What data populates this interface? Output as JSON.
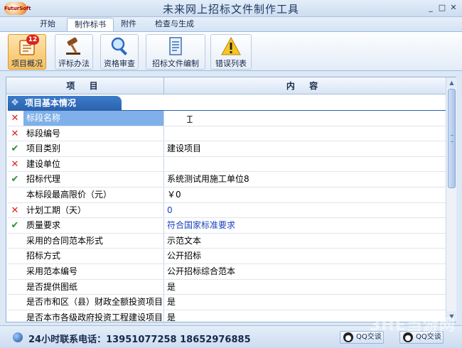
{
  "app": {
    "title": "未来网上招标文件制作工具",
    "logo_text": "FuturSoft"
  },
  "window": {
    "min": "_",
    "max": "□",
    "close": "✕"
  },
  "tabs": [
    "开始",
    "制作标书",
    "附件",
    "检查与生成"
  ],
  "active_tab": "制作标书",
  "ribbon": [
    {
      "label": "项目概况",
      "icon": "project-overview-icon",
      "badge": "12",
      "active": true
    },
    {
      "label": "评标办法",
      "icon": "gavel-icon",
      "active": false
    },
    {
      "label": "资格审查",
      "icon": "magnifier-icon",
      "active": false
    },
    {
      "label": "招标文件编制",
      "icon": "document-icon",
      "active": false
    },
    {
      "label": "错误列表",
      "icon": "warning-icon",
      "active": false
    }
  ],
  "grid": {
    "col_item": "项 目",
    "col_content": "内 容",
    "section": "项目基本情况",
    "rows": [
      {
        "status": "x",
        "label": "标段名称",
        "value": ""
      },
      {
        "status": "x",
        "label": "标段编号",
        "value": ""
      },
      {
        "status": "ok",
        "label": "项目类别",
        "value": "建设项目"
      },
      {
        "status": "x",
        "label": "建设单位",
        "value": ""
      },
      {
        "status": "ok",
        "label": "招标代理",
        "value": "系统测试用施工单位8"
      },
      {
        "status": "",
        "label": "本标段最高限价（元）",
        "value": "￥0"
      },
      {
        "status": "x",
        "label": "计划工期（天）",
        "value": "0"
      },
      {
        "status": "ok",
        "label": "质量要求",
        "value": "符合国家标准要求"
      },
      {
        "status": "",
        "label": "采用的合同范本形式",
        "value": "示范文本"
      },
      {
        "status": "",
        "label": "招标方式",
        "value": "公开招标"
      },
      {
        "status": "",
        "label": "采用范本编号",
        "value": "公开招标综合范本"
      },
      {
        "status": "",
        "label": "是否提供图纸",
        "value": "是"
      },
      {
        "status": "",
        "label": "是否市和区（县）财政全额投资项目",
        "value": "是"
      },
      {
        "status": "",
        "label": "是否本市各级政府投资工程建设项目",
        "value": "是"
      }
    ]
  },
  "status": {
    "phone": "24小时联系电话：13951077258 18652976885",
    "qq1": "QQ交谈",
    "qq2": "QQ交谈"
  },
  "watermark": "3HE当游网",
  "colors": {
    "error": "#d9231b",
    "ok": "#2f8f2f",
    "selected": "#7fb0e9",
    "section": "#2a61ad",
    "link_value": "#1a3fbf"
  }
}
